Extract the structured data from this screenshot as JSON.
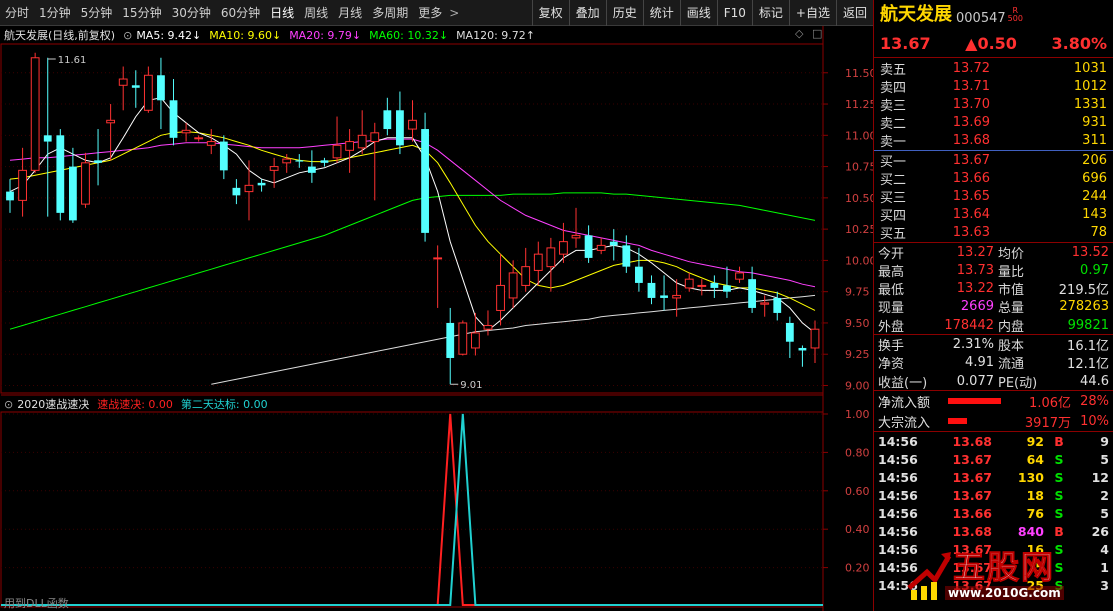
{
  "toolbar": {
    "tabs": [
      "分时",
      "1分钟",
      "5分钟",
      "15分钟",
      "30分钟",
      "60分钟",
      "日线",
      "周线",
      "月线",
      "多周期",
      "更多"
    ],
    "active_tab": "日线",
    "right_buttons": [
      "复权",
      "叠加",
      "历史",
      "统计",
      "画线",
      "F10",
      "标记",
      "+自选",
      "返回"
    ]
  },
  "main_legend": {
    "title": "航天发展(日线,前复权)",
    "ma5": "MA5: 9.42↓",
    "ma10": "MA10: 9.60↓",
    "ma20": "MA20: 9.79↓",
    "ma60": "MA60: 10.32↓",
    "ma120": "MA120: 9.72↑",
    "colors": {
      "ma5": "#ffffff",
      "ma10": "#ffff00",
      "ma20": "#ff40ff",
      "ma60": "#00ff00",
      "ma120": "#dddddd"
    }
  },
  "indicator_legend": {
    "name": "2020速战速决",
    "line1": "速战速决: 0.00",
    "line2": "第二天达标: 0.00"
  },
  "bottom_tip": "用到DLL函数",
  "chart_data": [
    {
      "type": "candlestick",
      "title": "航天发展(日线,前复权)",
      "y_ticks": [
        "11.50",
        "11.25",
        "11.00",
        "10.75",
        "10.50",
        "10.25",
        "10.00",
        "9.75",
        "9.50",
        "9.25",
        "9.00"
      ],
      "ylim": [
        8.94,
        11.73
      ],
      "annotations": [
        {
          "text": "11.61",
          "value": 11.61
        },
        {
          "text": "9.01",
          "value": 9.01
        }
      ],
      "candles": [
        [
          10.55,
          10.48,
          10.65,
          10.38
        ],
        [
          10.48,
          10.72,
          10.9,
          10.35
        ],
        [
          10.72,
          11.62,
          11.66,
          10.7
        ],
        [
          11.0,
          10.95,
          11.62,
          10.35
        ],
        [
          11.0,
          10.38,
          11.05,
          10.32
        ],
        [
          10.75,
          10.32,
          10.9,
          10.3
        ],
        [
          10.45,
          10.78,
          10.86,
          10.42
        ],
        [
          10.8,
          10.78,
          11.05,
          10.6
        ],
        [
          11.1,
          11.12,
          11.25,
          10.8
        ],
        [
          11.4,
          11.45,
          11.55,
          11.2
        ],
        [
          11.4,
          11.38,
          11.52,
          11.22
        ],
        [
          11.2,
          11.48,
          11.55,
          11.18
        ],
        [
          11.48,
          11.28,
          11.62,
          11.05
        ],
        [
          11.28,
          10.98,
          11.45,
          10.92
        ],
        [
          11.02,
          11.04,
          11.1,
          10.95
        ],
        [
          10.98,
          10.98,
          11.0,
          10.95
        ],
        [
          10.92,
          10.95,
          11.05,
          10.85
        ],
        [
          10.95,
          10.72,
          11.0,
          10.65
        ],
        [
          10.58,
          10.52,
          10.65,
          10.45
        ],
        [
          10.55,
          10.6,
          10.8,
          10.32
        ],
        [
          10.62,
          10.6,
          10.65,
          10.55
        ],
        [
          10.72,
          10.75,
          10.82,
          10.58
        ],
        [
          10.78,
          10.81,
          10.85,
          10.7
        ],
        [
          10.8,
          10.79,
          10.85,
          10.74
        ],
        [
          10.75,
          10.7,
          10.88,
          10.62
        ],
        [
          10.8,
          10.78,
          10.82,
          10.75
        ],
        [
          10.82,
          10.92,
          11.15,
          10.78
        ],
        [
          10.88,
          10.95,
          11.05,
          10.7
        ],
        [
          10.9,
          11.0,
          11.2,
          10.85
        ],
        [
          10.95,
          11.02,
          11.1,
          10.48
        ],
        [
          11.2,
          11.05,
          11.3,
          11.0
        ],
        [
          11.2,
          10.92,
          11.35,
          10.85
        ],
        [
          11.05,
          11.12,
          11.28,
          10.95
        ],
        [
          11.05,
          10.22,
          11.18,
          10.15
        ],
        [
          10.02,
          10.02,
          10.12,
          9.62
        ],
        [
          9.5,
          9.22,
          9.62,
          9.01
        ],
        [
          9.25,
          9.5,
          9.52,
          9.24
        ],
        [
          9.3,
          9.42,
          9.58,
          9.24
        ],
        [
          9.45,
          9.48,
          9.6,
          9.4
        ],
        [
          9.6,
          9.8,
          10.05,
          9.48
        ],
        [
          9.7,
          9.9,
          10.0,
          9.62
        ],
        [
          9.8,
          9.95,
          10.1,
          9.75
        ],
        [
          9.92,
          10.05,
          10.15,
          9.8
        ],
        [
          9.95,
          10.1,
          10.18,
          9.75
        ],
        [
          10.05,
          10.15,
          10.3,
          9.98
        ],
        [
          10.18,
          10.2,
          10.42,
          10.1
        ],
        [
          10.2,
          10.02,
          10.28,
          9.98
        ],
        [
          10.08,
          10.12,
          10.18,
          10.05
        ],
        [
          10.15,
          10.12,
          10.25,
          10.0
        ],
        [
          10.12,
          9.95,
          10.2,
          9.9
        ],
        [
          9.95,
          9.82,
          10.1,
          9.75
        ],
        [
          9.82,
          9.7,
          9.88,
          9.65
        ],
        [
          9.72,
          9.7,
          9.88,
          9.6
        ],
        [
          9.7,
          9.72,
          9.85,
          9.55
        ],
        [
          9.78,
          9.85,
          9.9,
          9.75
        ],
        [
          9.8,
          9.8,
          9.85,
          9.72
        ],
        [
          9.82,
          9.78,
          9.88,
          9.7
        ],
        [
          9.8,
          9.75,
          9.95,
          9.7
        ],
        [
          9.85,
          9.9,
          9.95,
          9.82
        ],
        [
          9.85,
          9.62,
          9.95,
          9.58
        ],
        [
          9.65,
          9.66,
          9.72,
          9.55
        ],
        [
          9.7,
          9.58,
          9.75,
          9.52
        ],
        [
          9.5,
          9.35,
          9.55,
          9.22
        ],
        [
          9.3,
          9.28,
          9.32,
          9.15
        ],
        [
          9.3,
          9.45,
          9.52,
          9.18
        ]
      ],
      "ma5": [
        10.55,
        10.6,
        10.72,
        10.85,
        10.9,
        10.85,
        10.8,
        10.78,
        10.82,
        10.98,
        11.15,
        11.28,
        11.3,
        11.18,
        11.1,
        11.02,
        10.98,
        10.92,
        10.85,
        10.72,
        10.65,
        10.62,
        10.66,
        10.7,
        10.72,
        10.74,
        10.78,
        10.82,
        10.88,
        10.95,
        10.98,
        10.98,
        10.98,
        10.82,
        10.55,
        10.15,
        9.85,
        9.55,
        9.44,
        9.52,
        9.62,
        9.72,
        9.82,
        9.92,
        10.02,
        10.08,
        10.08,
        10.1,
        10.12,
        10.1,
        10.05,
        9.98,
        9.9,
        9.82,
        9.78,
        9.76,
        9.76,
        9.76,
        9.78,
        9.76,
        9.73,
        9.7,
        9.62,
        9.5,
        9.42
      ],
      "ma10": [
        10.65,
        10.66,
        10.68,
        10.7,
        10.72,
        10.74,
        10.76,
        10.78,
        10.8,
        10.85,
        10.9,
        10.95,
        11.0,
        11.02,
        11.03,
        11.02,
        11.0,
        10.98,
        10.95,
        10.92,
        10.88,
        10.85,
        10.82,
        10.8,
        10.79,
        10.79,
        10.8,
        10.82,
        10.84,
        10.86,
        10.88,
        10.9,
        10.92,
        10.88,
        10.78,
        10.62,
        10.45,
        10.28,
        10.15,
        10.05,
        9.95,
        9.85,
        9.8,
        9.78,
        9.8,
        9.84,
        9.88,
        9.92,
        9.96,
        9.98,
        10.0,
        10.0,
        9.98,
        9.95,
        9.9,
        9.86,
        9.82,
        9.8,
        9.78,
        9.78,
        9.76,
        9.74,
        9.7,
        9.65,
        9.6
      ],
      "ma20": [
        10.8,
        10.81,
        10.82,
        10.82,
        10.83,
        10.84,
        10.85,
        10.86,
        10.87,
        10.88,
        10.89,
        10.9,
        10.92,
        10.93,
        10.94,
        10.94,
        10.94,
        10.93,
        10.92,
        10.91,
        10.9,
        10.9,
        10.9,
        10.9,
        10.91,
        10.92,
        10.93,
        10.94,
        10.95,
        10.96,
        10.97,
        10.97,
        10.97,
        10.94,
        10.88,
        10.8,
        10.72,
        10.64,
        10.56,
        10.48,
        10.42,
        10.36,
        10.32,
        10.28,
        10.24,
        10.22,
        10.2,
        10.18,
        10.16,
        10.14,
        10.12,
        10.08,
        10.05,
        10.02,
        9.99,
        9.97,
        9.95,
        9.93,
        9.91,
        9.9,
        9.88,
        9.86,
        9.84,
        9.81,
        9.79
      ],
      "ma60": [
        9.45,
        9.48,
        9.51,
        9.54,
        9.57,
        9.6,
        9.63,
        9.66,
        9.69,
        9.72,
        9.75,
        9.78,
        9.81,
        9.84,
        9.87,
        9.9,
        9.93,
        9.96,
        9.99,
        10.02,
        10.05,
        10.08,
        10.11,
        10.14,
        10.17,
        10.2,
        10.24,
        10.28,
        10.32,
        10.36,
        10.4,
        10.44,
        10.48,
        10.5,
        10.51,
        10.52,
        10.52,
        10.52,
        10.52,
        10.52,
        10.53,
        10.53,
        10.53,
        10.53,
        10.54,
        10.54,
        10.54,
        10.54,
        10.53,
        10.53,
        10.52,
        10.51,
        10.5,
        10.49,
        10.48,
        10.47,
        10.46,
        10.45,
        10.44,
        10.42,
        10.4,
        10.38,
        10.36,
        10.34,
        10.32
      ],
      "ma120": [
        null,
        null,
        null,
        null,
        null,
        null,
        null,
        null,
        null,
        null,
        null,
        null,
        null,
        null,
        null,
        null,
        9.01,
        9.03,
        9.05,
        9.07,
        9.09,
        9.11,
        9.13,
        9.15,
        9.17,
        9.19,
        9.21,
        9.23,
        9.25,
        9.27,
        9.29,
        9.31,
        9.33,
        9.35,
        9.37,
        9.39,
        9.41,
        9.43,
        9.44,
        9.45,
        9.46,
        9.48,
        9.49,
        9.5,
        9.51,
        9.52,
        9.53,
        9.55,
        9.56,
        9.57,
        9.58,
        9.59,
        9.6,
        9.61,
        9.62,
        9.63,
        9.64,
        9.65,
        9.66,
        9.67,
        9.68,
        9.69,
        9.7,
        9.71,
        9.72
      ]
    },
    {
      "type": "line",
      "title": "2020速战速决",
      "y_ticks": [
        "1.00",
        "0.80",
        "0.60",
        "0.40",
        "0.20"
      ],
      "ylim": [
        0,
        1.0
      ],
      "series": [
        {
          "name": "速战速决",
          "color": "#ff2020",
          "spike_index": 35,
          "peak": 1.0
        },
        {
          "name": "第二天达标",
          "color": "#20d0d0",
          "spike_index": 36,
          "peak": 1.0
        }
      ]
    }
  ],
  "quote": {
    "name": "航天发展",
    "code": "000547",
    "badge_top": "R",
    "badge_bottom": "500",
    "price": "13.67",
    "change": "▲0.50",
    "pct": "3.80%",
    "sell": [
      {
        "label": "卖五",
        "price": "13.72",
        "vol": "1031"
      },
      {
        "label": "卖四",
        "price": "13.71",
        "vol": "1012"
      },
      {
        "label": "卖三",
        "price": "13.70",
        "vol": "1331"
      },
      {
        "label": "卖二",
        "price": "13.69",
        "vol": "931"
      },
      {
        "label": "卖一",
        "price": "13.68",
        "vol": "311"
      }
    ],
    "buy": [
      {
        "label": "买一",
        "price": "13.67",
        "vol": "206"
      },
      {
        "label": "买二",
        "price": "13.66",
        "vol": "696"
      },
      {
        "label": "买三",
        "price": "13.65",
        "vol": "244"
      },
      {
        "label": "买四",
        "price": "13.64",
        "vol": "143"
      },
      {
        "label": "买五",
        "price": "13.63",
        "vol": "78"
      }
    ],
    "stats1": [
      {
        "l1": "今开",
        "v1": "13.27",
        "c1": "red",
        "l2": "均价",
        "v2": "13.52",
        "c2": "red"
      },
      {
        "l1": "最高",
        "v1": "13.73",
        "c1": "red",
        "l2": "量比",
        "v2": "0.97",
        "c2": "grn"
      },
      {
        "l1": "最低",
        "v1": "13.22",
        "c1": "red",
        "l2": "市值",
        "v2": "219.5亿",
        "c2": "wht"
      },
      {
        "l1": "现量",
        "v1": "2669",
        "c1": "mag",
        "l2": "总量",
        "v2": "278263",
        "c2": "yel"
      },
      {
        "l1": "外盘",
        "v1": "178442",
        "c1": "red",
        "l2": "内盘",
        "v2": "99821",
        "c2": "grn"
      }
    ],
    "stats2": [
      {
        "l1": "换手",
        "v1": "2.31%",
        "l2": "股本",
        "v2": "16.1亿"
      },
      {
        "l1": "净资",
        "v1": "4.91",
        "l2": "流通",
        "v2": "12.1亿"
      },
      {
        "l1": "收益(一)",
        "v1": "0.077",
        "l2": "PE(动)",
        "v2": "44.6"
      }
    ],
    "flows": [
      {
        "label": "净流入额",
        "value": "1.06亿",
        "pct": "28%",
        "bar": 0.28
      },
      {
        "label": "大宗流入",
        "value": "3917万",
        "pct": "10%",
        "bar": 0.1
      }
    ],
    "ticks": [
      {
        "time": "14:56",
        "price": "13.68",
        "vol": "92",
        "vc": "yel",
        "dir": "B",
        "dc": "red",
        "n": "9"
      },
      {
        "time": "14:56",
        "price": "13.67",
        "vol": "64",
        "vc": "yel",
        "dir": "S",
        "dc": "grn",
        "n": "5"
      },
      {
        "time": "14:56",
        "price": "13.67",
        "vol": "130",
        "vc": "yel",
        "dir": "S",
        "dc": "grn",
        "n": "12"
      },
      {
        "time": "14:56",
        "price": "13.67",
        "vol": "18",
        "vc": "yel",
        "dir": "S",
        "dc": "grn",
        "n": "2"
      },
      {
        "time": "14:56",
        "price": "13.66",
        "vol": "76",
        "vc": "yel",
        "dir": "S",
        "dc": "grn",
        "n": "5"
      },
      {
        "time": "14:56",
        "price": "13.68",
        "vol": "840",
        "vc": "mag",
        "dir": "B",
        "dc": "red",
        "n": "26"
      },
      {
        "time": "14:56",
        "price": "13.67",
        "vol": "16",
        "vc": "yel",
        "dir": "S",
        "dc": "grn",
        "n": "4"
      },
      {
        "time": "14:56",
        "price": "13.67",
        "vol": "5",
        "vc": "yel",
        "dir": "S",
        "dc": "grn",
        "n": "1"
      },
      {
        "time": "14:56",
        "price": "13.67",
        "vol": "25",
        "vc": "yel",
        "dir": "S",
        "dc": "grn",
        "n": "3"
      }
    ]
  },
  "watermark": {
    "text": "五股网",
    "url": "www.2010G.com"
  }
}
